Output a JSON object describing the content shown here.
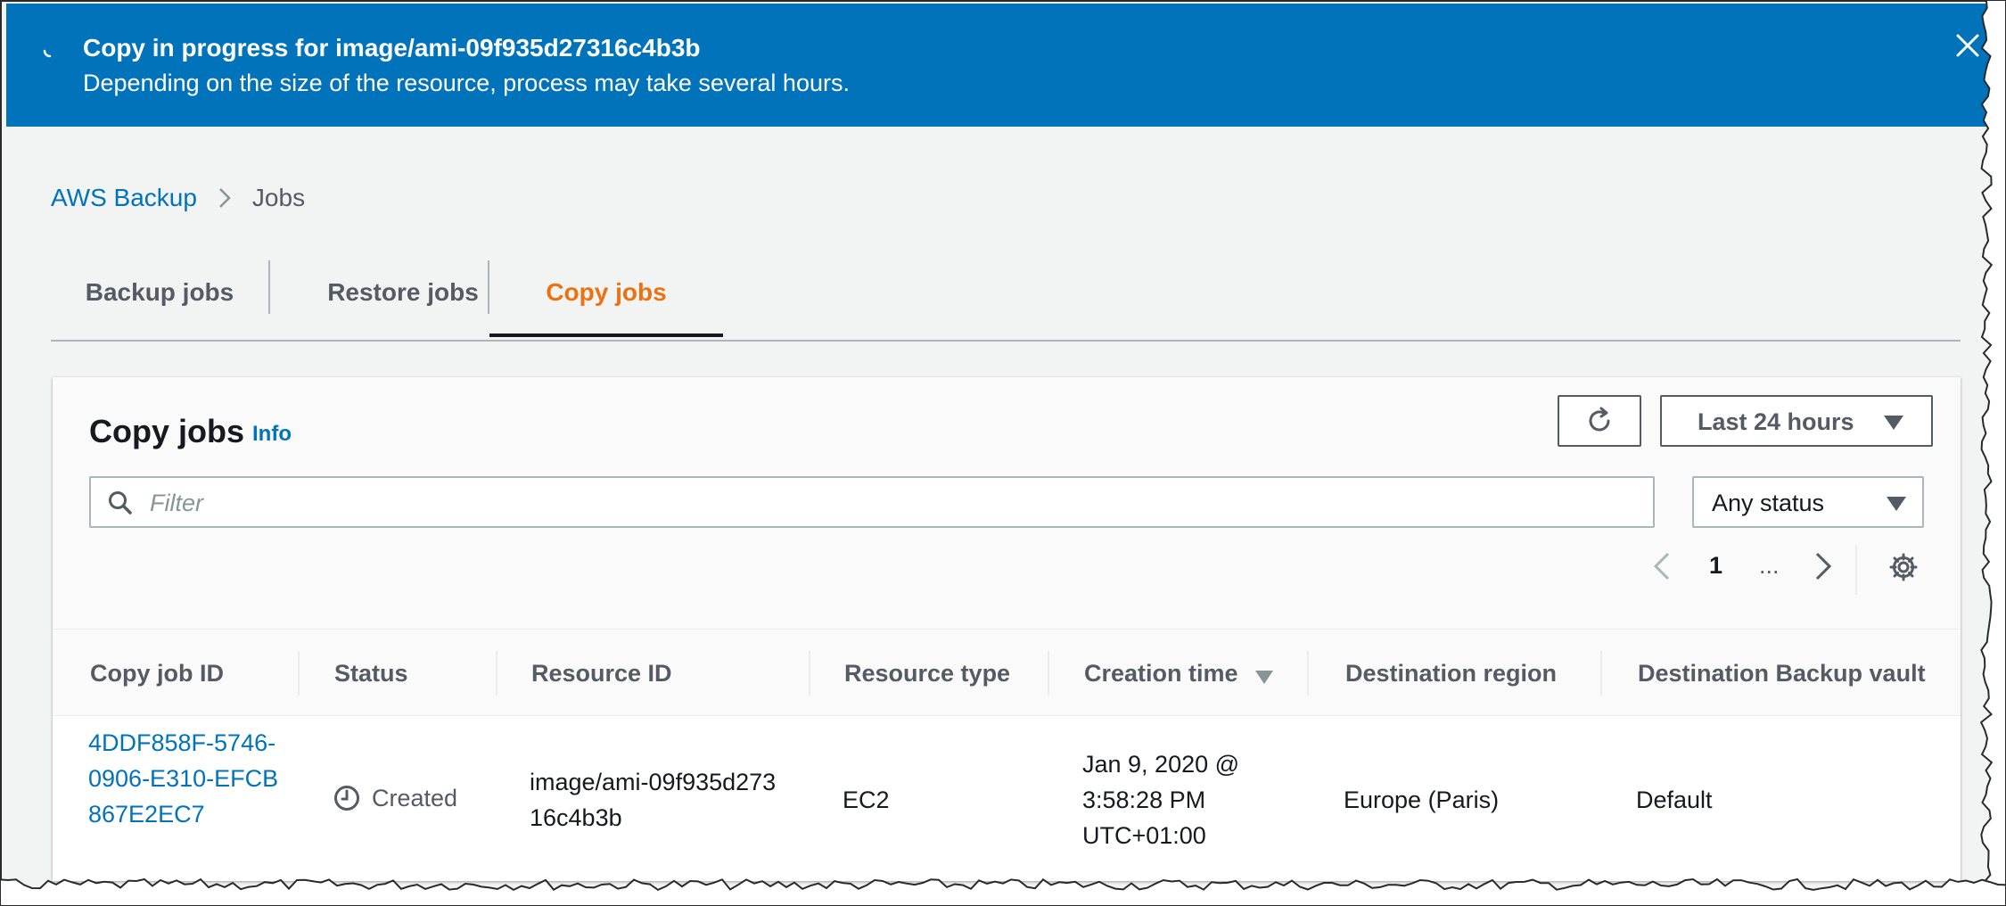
{
  "flash": {
    "title": "Copy in progress for image/ami-09f935d27316c4b3b",
    "message": "Depending on the size of the resource, process may take several hours.",
    "color": "#0073bb",
    "icons": {
      "status": "spinner-icon",
      "dismiss": "close-icon"
    }
  },
  "breadcrumb": {
    "items": [
      "AWS Backup",
      "Jobs"
    ]
  },
  "tabs": [
    {
      "label": "Backup jobs",
      "active": false
    },
    {
      "label": "Restore jobs",
      "active": false
    },
    {
      "label": "Copy jobs",
      "active": true
    }
  ],
  "panel": {
    "title": "Copy jobs",
    "info_label": "Info",
    "time_range": {
      "selected": "Last 24 hours"
    },
    "filter": {
      "placeholder": "Filter",
      "value": ""
    },
    "status_filter": {
      "selected": "Any status"
    },
    "pagination": {
      "current_page": "1",
      "ellipsis": "..."
    }
  },
  "table": {
    "columns": [
      "Copy job ID",
      "Status",
      "Resource ID",
      "Resource type",
      "Creation time",
      "Destination region",
      "Destination Backup vault"
    ],
    "sorted_column": "Creation time",
    "rows": [
      {
        "copy_job_id": "4DDF858F-5746-0906-E310-EFCB867E2EC7",
        "status": "Created",
        "resource_id": "image/ami-09f935d27316c4b3b",
        "resource_type": "EC2",
        "creation_time_lines": [
          "Jan 9, 2020 @",
          "3:58:28 PM",
          "UTC+01:00"
        ],
        "destination_region": "Europe (Paris)",
        "destination_vault": "Default"
      }
    ]
  },
  "colors": {
    "accent_link": "#0073bb",
    "active_tab": "#ec7211",
    "page_background": "#f2f3f3"
  }
}
